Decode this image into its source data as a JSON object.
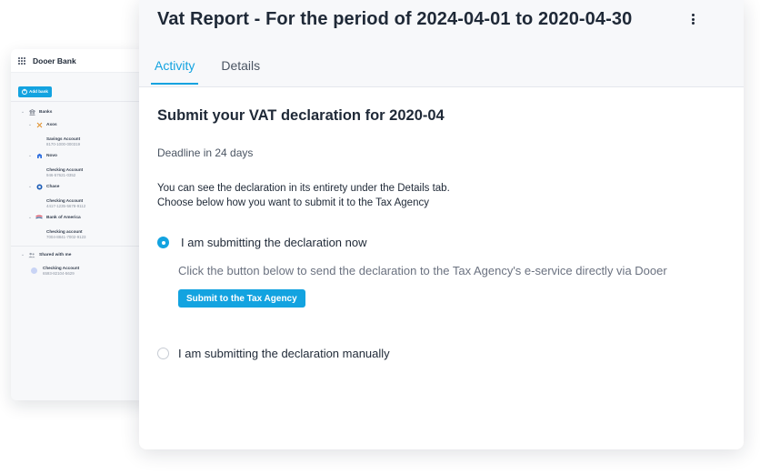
{
  "bank_panel": {
    "title": "Dooer Bank",
    "add_bank_label": "Add bank",
    "banks_label": "Banks",
    "banks": [
      {
        "name": "Axos",
        "account_name": "Savings Account",
        "account_number": "8170-1000-000319"
      },
      {
        "name": "Novo",
        "account_name": "Checking Account",
        "account_number": "946-57621-0352"
      },
      {
        "name": "Chase",
        "account_name": "Checking Account",
        "account_number": "4417-1235-5678-9112"
      },
      {
        "name": "Bank of America",
        "account_name": "Checking account",
        "account_number": "7004-8841-7002-9123"
      }
    ],
    "shared_label": "Shared with me",
    "shared_account": {
      "account_name": "Checking Account",
      "account_number": "6593-82104-5629"
    }
  },
  "report": {
    "title": "Vat Report - For the period of  2024-04-01 to 2020-04-30",
    "tabs": [
      {
        "label": "Activity",
        "active": true
      },
      {
        "label": "Details",
        "active": false
      }
    ],
    "heading": "Submit your VAT declaration for 2020-04",
    "deadline": "Deadline in 24 days",
    "info_line1": "You can see the declaration in its entirety under the Details tab.",
    "info_line2": "Choose below how you want to submit it to the Tax Agency",
    "option_now": {
      "label": "I am submitting the declaration now",
      "selected": true,
      "description": "Click the button below to send the declaration to the Tax Agency's e-service directly via Dooer",
      "button_label": "Submit to the Tax Agency"
    },
    "option_manual": {
      "label": "I am submitting the declaration manually",
      "selected": false
    }
  },
  "colors": {
    "accent": "#13a3e0",
    "panel_bg": "#f7f8fa",
    "text": "#1f2937",
    "muted": "#6b7280"
  },
  "icons": {
    "bank_panel": "grid-icon",
    "banks": "bank-building-icon",
    "shared": "people-icon",
    "menu": "kebab-menu-icon"
  }
}
